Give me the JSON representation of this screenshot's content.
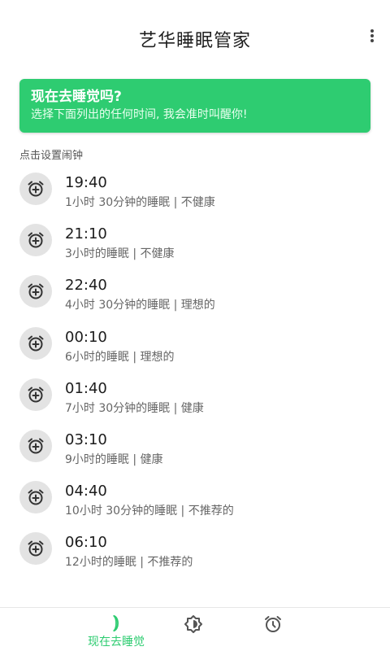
{
  "header": {
    "title": "艺华睡眠管家",
    "menu_icon": "more-vert-icon"
  },
  "banner": {
    "title": "现在去睡觉吗?",
    "subtitle": "选择下面列出的任何时间, 我会准时叫醒你!",
    "color": "#2ecc71"
  },
  "section_label": "点击设置闹钟",
  "alarms": [
    {
      "time": "19:40",
      "desc": "1小时 30分钟的睡眠 | 不健康",
      "icon": "alarm-add-icon"
    },
    {
      "time": "21:10",
      "desc": "3小时的睡眠 | 不健康",
      "icon": "alarm-add-icon"
    },
    {
      "time": "22:40",
      "desc": "4小时 30分钟的睡眠 | 理想的",
      "icon": "alarm-add-icon"
    },
    {
      "time": "00:10",
      "desc": "6小时的睡眠 | 理想的",
      "icon": "alarm-add-icon"
    },
    {
      "time": "01:40",
      "desc": "7小时 30分钟的睡眠 | 健康",
      "icon": "alarm-add-icon"
    },
    {
      "time": "03:10",
      "desc": "9小时的睡眠 | 健康",
      "icon": "alarm-add-icon"
    },
    {
      "time": "04:40",
      "desc": "10小时 30分钟的睡眠 | 不推荐的",
      "icon": "alarm-add-icon"
    },
    {
      "time": "06:10",
      "desc": "12小时的睡眠 | 不推荐的",
      "icon": "alarm-add-icon"
    }
  ],
  "bottom_nav": {
    "items": [
      {
        "label": "现在去睡觉",
        "icon": "moon-icon",
        "active": true
      },
      {
        "label": "",
        "icon": "brightness-icon",
        "active": false
      },
      {
        "label": "",
        "icon": "alarm-clock-icon",
        "active": false
      }
    ],
    "active_color": "#2ecc71",
    "inactive_color": "#555555"
  }
}
